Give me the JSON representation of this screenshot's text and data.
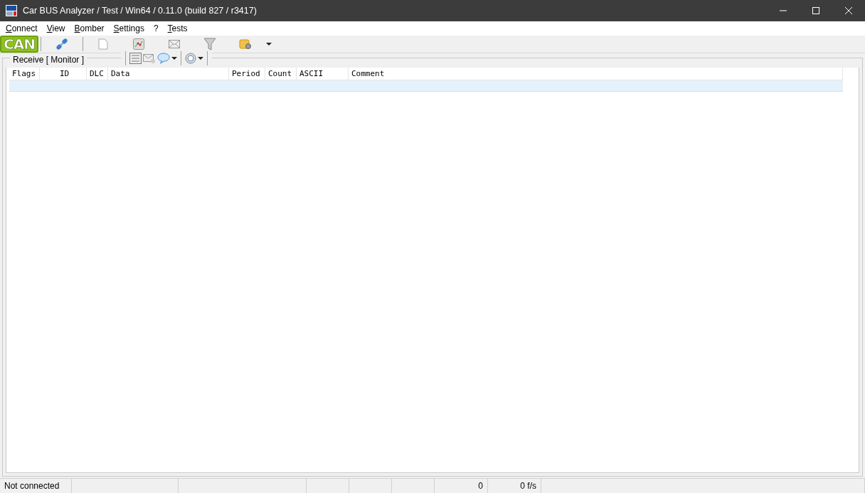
{
  "window": {
    "title": "Car BUS Analyzer / Test / Win64 / 0.11.0 (build 827 / r3417)"
  },
  "menu": [
    {
      "label": "Connect",
      "accel": true
    },
    {
      "label": "View",
      "accel": true
    },
    {
      "label": "Bomber",
      "accel": true
    },
    {
      "label": "Settings",
      "accel": true
    },
    {
      "label": "?"
    },
    {
      "label": "Tests",
      "accel": true
    }
  ],
  "toolbar": {
    "logo": "CAN"
  },
  "monitor": {
    "title": "Receive [ Monitor ]",
    "table": {
      "columns": [
        "Flags",
        "ID",
        "DLC",
        "Data",
        "Period",
        "Count",
        "ASCII",
        "Comment"
      ],
      "rows": [
        {
          "selected": true
        }
      ]
    }
  },
  "status_bar": {
    "connection": "Not connected",
    "frame_count": "0",
    "frame_rate": "0 f/s"
  }
}
